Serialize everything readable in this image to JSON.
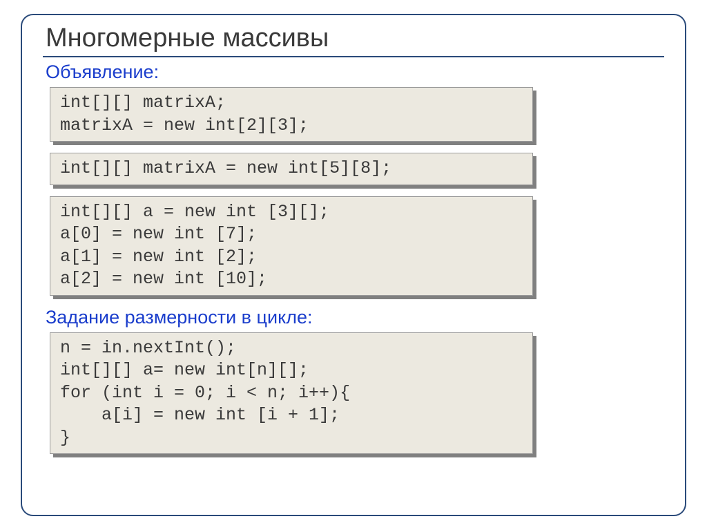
{
  "title": "Многомерные массивы",
  "section1": "Объявление:",
  "code1": "int[][] matrixA;\nmatrixA = new int[2][3];",
  "code2": "int[][] matrixA = new int[5][8];",
  "code3": "int[][] a = new int [3][];\na[0] = new int [7];\na[1] = new int [2];\na[2] = new int [10];",
  "section2": "Задание размерности в цикле:",
  "code4": "n = in.nextInt();\nint[][] a= new int[n][];\nfor (int i = 0; i < n; i++){\n    a[i] = new int [i + 1];\n}"
}
